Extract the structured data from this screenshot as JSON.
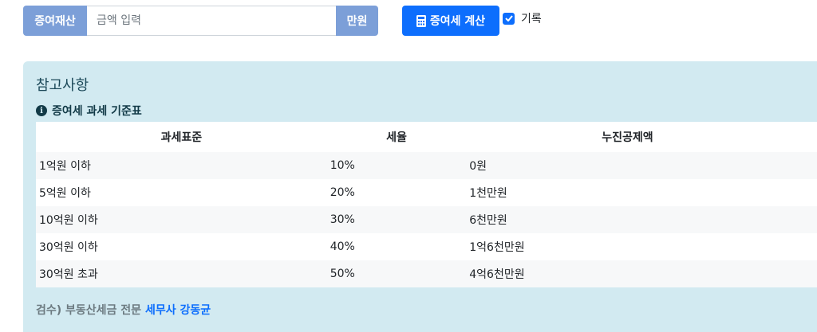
{
  "form": {
    "addon_left": "증여재산",
    "amount_placeholder": "금액 입력",
    "amount_value": "",
    "addon_right": "만원",
    "calc_button": "증여세 계산",
    "record_label": "기록",
    "record_checked": true
  },
  "reference": {
    "title": "참고사항",
    "subtitle": "증여세 과세 기준표",
    "headers": [
      "과세표준",
      "세율",
      "누진공제액"
    ],
    "rows": [
      [
        "1억원 이하",
        "10%",
        "0원"
      ],
      [
        "5억원 이하",
        "20%",
        "1천만원"
      ],
      [
        "10억원 이하",
        "30%",
        "6천만원"
      ],
      [
        "30억원 이하",
        "40%",
        "1억6천만원"
      ],
      [
        "30억원 초과",
        "50%",
        "4억6천만원"
      ]
    ],
    "footer_prefix": "검수) 부동산세금 전문",
    "footer_link": "세무사 강동균"
  },
  "colors": {
    "addon_bg": "#7c9fd8",
    "primary": "#0d6efd",
    "panel_bg": "#d2eaf1"
  },
  "icons": {
    "calc_button_icon": "calculator-icon",
    "subtitle_icon": "info-circle-icon",
    "record_check_icon": "checkmark-icon"
  }
}
